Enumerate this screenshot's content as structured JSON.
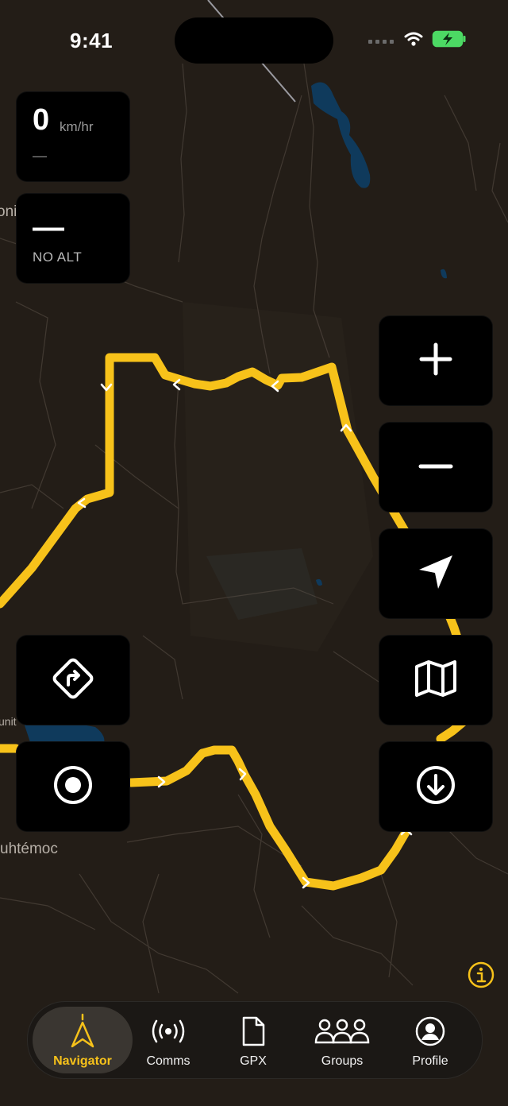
{
  "status_bar": {
    "time": "9:41",
    "icons": [
      "signal-dots-icon",
      "wifi-icon",
      "battery-charging-icon"
    ],
    "battery_color": "#4cd964"
  },
  "speed_panel": {
    "value": "0",
    "unit": "km/hr",
    "sub": "—"
  },
  "altitude_panel": {
    "value": "—",
    "label": "NO ALT"
  },
  "map": {
    "labels": {
      "left_top": "oni",
      "left_mid": "unit",
      "bottom_left": "uhtémoc"
    },
    "route_color": "#f7c21a",
    "background_color": "#231d17",
    "water_color": "#0f3a5c"
  },
  "map_controls": {
    "zoom_in_icon": "plus-icon",
    "zoom_out_icon": "minus-icon",
    "locate_icon": "location-arrow-icon",
    "map_layers_icon": "map-icon",
    "download_icon": "download-circle-icon",
    "directions_icon": "directions-sign-icon",
    "record_icon": "record-target-icon",
    "info_icon": "info-circle-icon"
  },
  "tabs": [
    {
      "label": "Navigator",
      "icon": "navigator-arrow-icon",
      "active": true
    },
    {
      "label": "Comms",
      "icon": "broadcast-icon",
      "active": false
    },
    {
      "label": "GPX",
      "icon": "file-icon",
      "active": false
    },
    {
      "label": "Groups",
      "icon": "groups-icon",
      "active": false
    },
    {
      "label": "Profile",
      "icon": "profile-icon",
      "active": false
    }
  ],
  "accent_color": "#f7c21a"
}
